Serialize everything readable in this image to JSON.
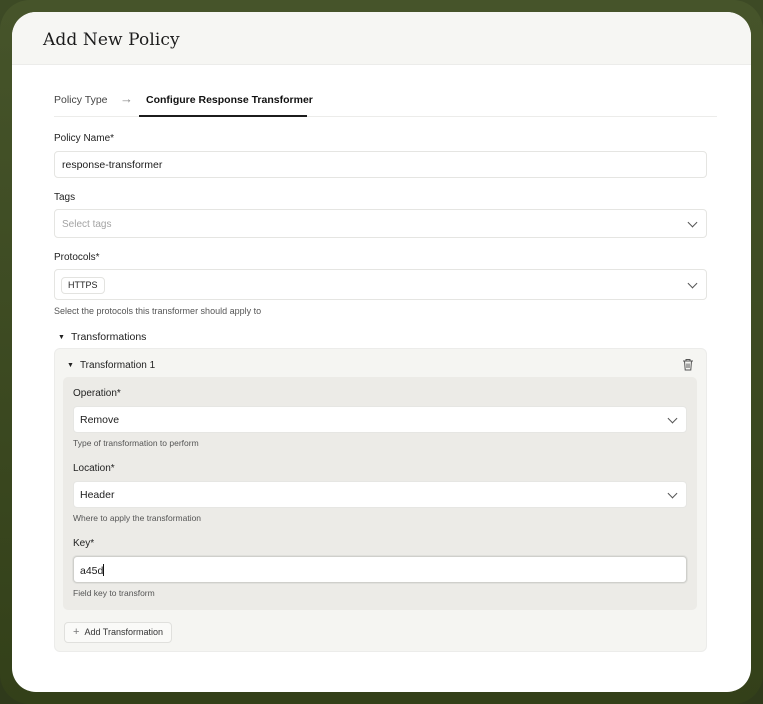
{
  "dialog": {
    "title": "Add New Policy"
  },
  "steps": {
    "step1": "Policy Type",
    "step2": "Configure Response Transformer"
  },
  "form": {
    "policy_name_label": "Policy Name*",
    "policy_name_value": "response-transformer",
    "tags_label": "Tags",
    "tags_placeholder": "Select tags",
    "protocols_label": "Protocols*",
    "protocols_selected": "HTTPS",
    "protocols_helper": "Select the protocols this transformer should apply to"
  },
  "transformations": {
    "section_label": "Transformations",
    "item_title": "Transformation 1",
    "operation_label": "Operation*",
    "operation_value": "Remove",
    "operation_helper": "Type of transformation to perform",
    "location_label": "Location*",
    "location_value": "Header",
    "location_helper": "Where to apply the transformation",
    "key_label": "Key*",
    "key_value": "a45d",
    "key_helper": "Field key to transform",
    "add_button": "Add Transformation"
  },
  "icons": {
    "arrow": "arrow-right-icon",
    "chevron": "chevron-down-icon",
    "trash": "trash-icon",
    "plus": "plus-icon",
    "triangle": "triangle-down-icon"
  },
  "colors": {
    "frame": "#3d4a25",
    "accent": "#1c1c1c"
  }
}
